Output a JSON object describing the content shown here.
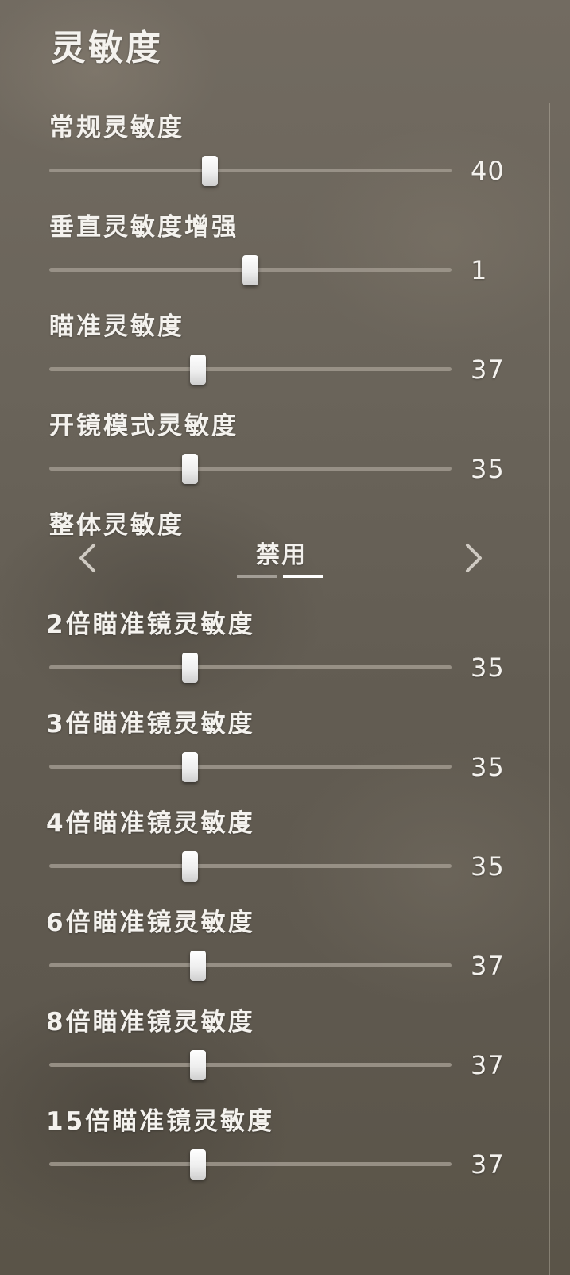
{
  "panel": {
    "title": "灵敏度"
  },
  "settings": [
    {
      "label": "常规灵敏度",
      "value": "40",
      "position": 0.4
    },
    {
      "label": "垂直灵敏度增强",
      "value": "1",
      "position": 0.5
    },
    {
      "label": "瞄准灵敏度",
      "value": "37",
      "position": 0.37
    },
    {
      "label": "开镜模式灵敏度",
      "value": "35",
      "position": 0.35
    },
    {
      "label": "整体灵敏度",
      "option": "禁用",
      "option_index": 1,
      "option_count": 2
    },
    {
      "label": "2倍瞄准镜灵敏度",
      "value": "35",
      "position": 0.35
    },
    {
      "label": "3倍瞄准镜灵敏度",
      "value": "35",
      "position": 0.35
    },
    {
      "label": "4倍瞄准镜灵敏度",
      "value": "35",
      "position": 0.35
    },
    {
      "label": "6倍瞄准镜灵敏度",
      "value": "37",
      "position": 0.37
    },
    {
      "label": "8倍瞄准镜灵敏度",
      "value": "37",
      "position": 0.37
    },
    {
      "label": "15倍瞄准镜灵敏度",
      "value": "37",
      "position": 0.37
    }
  ],
  "icons": {
    "left_arrow": "chevron-left-icon",
    "right_arrow": "chevron-right-icon"
  }
}
